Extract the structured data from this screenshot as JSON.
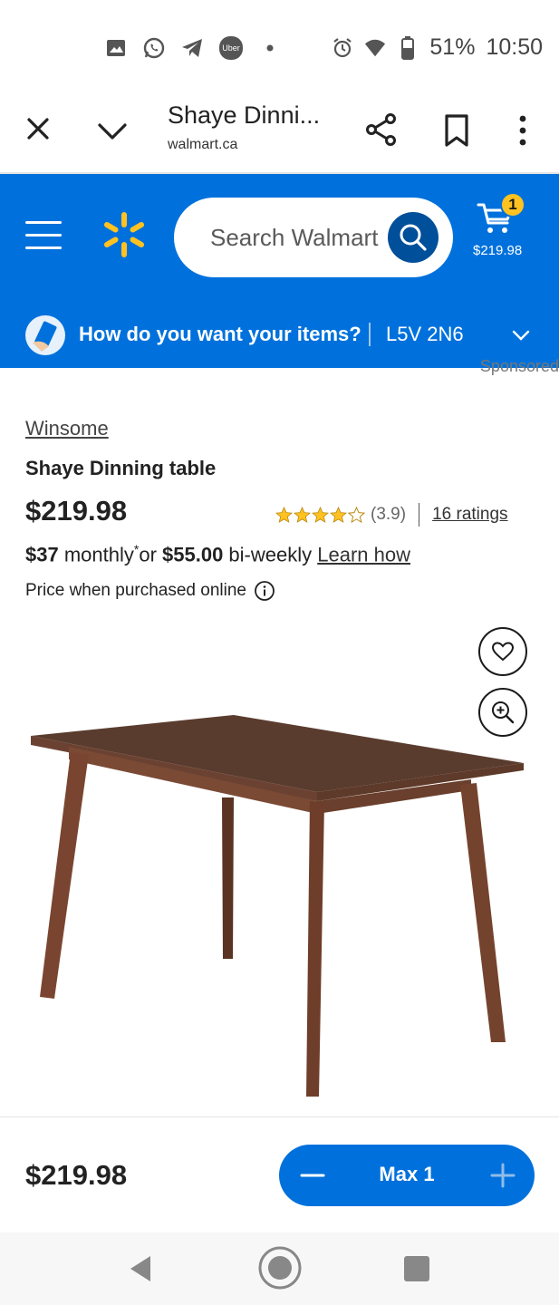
{
  "status_bar": {
    "battery": "51%",
    "time": "10:50",
    "uber_label": "Uber",
    "notification_icons": [
      "image-icon",
      "whatsapp-icon",
      "telegram-icon",
      "uber-icon",
      "dot-icon"
    ],
    "system_icons": [
      "alarm-icon",
      "wifi-icon",
      "battery-icon"
    ]
  },
  "browser": {
    "title": "Shaye Dinni...",
    "domain": "walmart.ca"
  },
  "header": {
    "search_placeholder": "Search Walmart",
    "cart_count": "1",
    "cart_total": "$219.98",
    "fulfillment_prompt": "How do you want your items?",
    "postal_code": "L5V 2N6",
    "brand_color": "#0071dc",
    "accent_color": "#ffc220"
  },
  "product": {
    "sponsored_label": "Sponsored",
    "brand": "Winsome",
    "name": "Shaye Dinning table",
    "price": "$219.98",
    "rating": 3.9,
    "rating_text": "(3.9)",
    "ratings_count_text": "16 ratings",
    "financing": {
      "monthly_amount": "$37",
      "monthly_suffix": " monthly",
      "asterisk": "*",
      "or_text": "or ",
      "biweekly_amount": "$55.00",
      "biweekly_suffix": " bi-weekly ",
      "learn_link": "Learn how"
    },
    "price_note": "Price when purchased online"
  },
  "sticky": {
    "price": "$219.98",
    "qty_label": "Max 1"
  }
}
